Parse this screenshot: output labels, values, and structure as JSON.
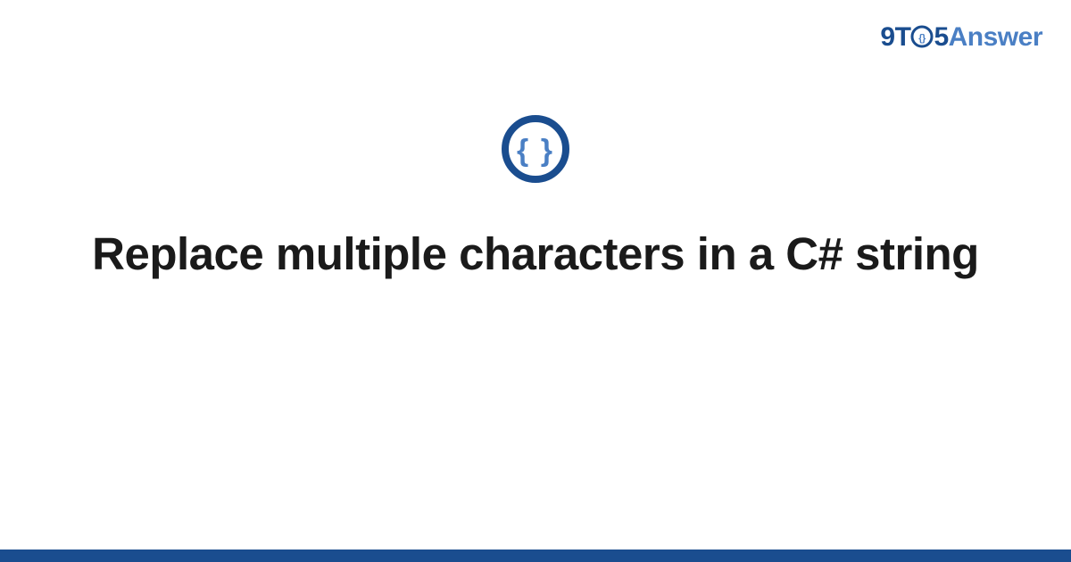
{
  "brand": {
    "part1": "9",
    "part2": "T",
    "part3": "5",
    "part4": "Answer"
  },
  "icon": {
    "name": "code-braces-icon",
    "glyph_left": "{",
    "glyph_right": "}"
  },
  "title": "Replace multiple characters in a C# string",
  "colors": {
    "brand_dark": "#1a4d8f",
    "brand_light": "#4a7fc4",
    "text": "#1a1a1a"
  }
}
